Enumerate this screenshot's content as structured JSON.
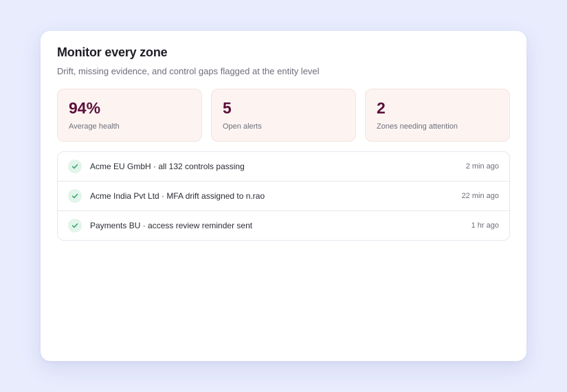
{
  "card": {
    "title": "Monitor every zone",
    "subtitle": "Drift, missing evidence, and control gaps flagged at the entity level"
  },
  "stats": [
    {
      "value": "94%",
      "label": "Average health"
    },
    {
      "value": "5",
      "label": "Open alerts"
    },
    {
      "value": "2",
      "label": "Zones needing attention"
    }
  ],
  "activity": [
    {
      "text": "Acme EU GmbH · all 132 controls passing",
      "time": "2 min ago",
      "icon": "check-icon",
      "status": "success"
    },
    {
      "text": "Acme India Pvt Ltd · MFA drift assigned to n.rao",
      "time": "22 min ago",
      "icon": "check-icon",
      "status": "success"
    },
    {
      "text": "Payments BU · access review reminder sent",
      "time": "1 hr ago",
      "icon": "check-icon",
      "status": "success"
    }
  ],
  "colors": {
    "background": "#e8ecfd",
    "stat_value": "#5b0f3a",
    "stat_background": "#fdf4f2",
    "check_background": "#e3f5ea",
    "check_mark": "#3aa76d"
  }
}
